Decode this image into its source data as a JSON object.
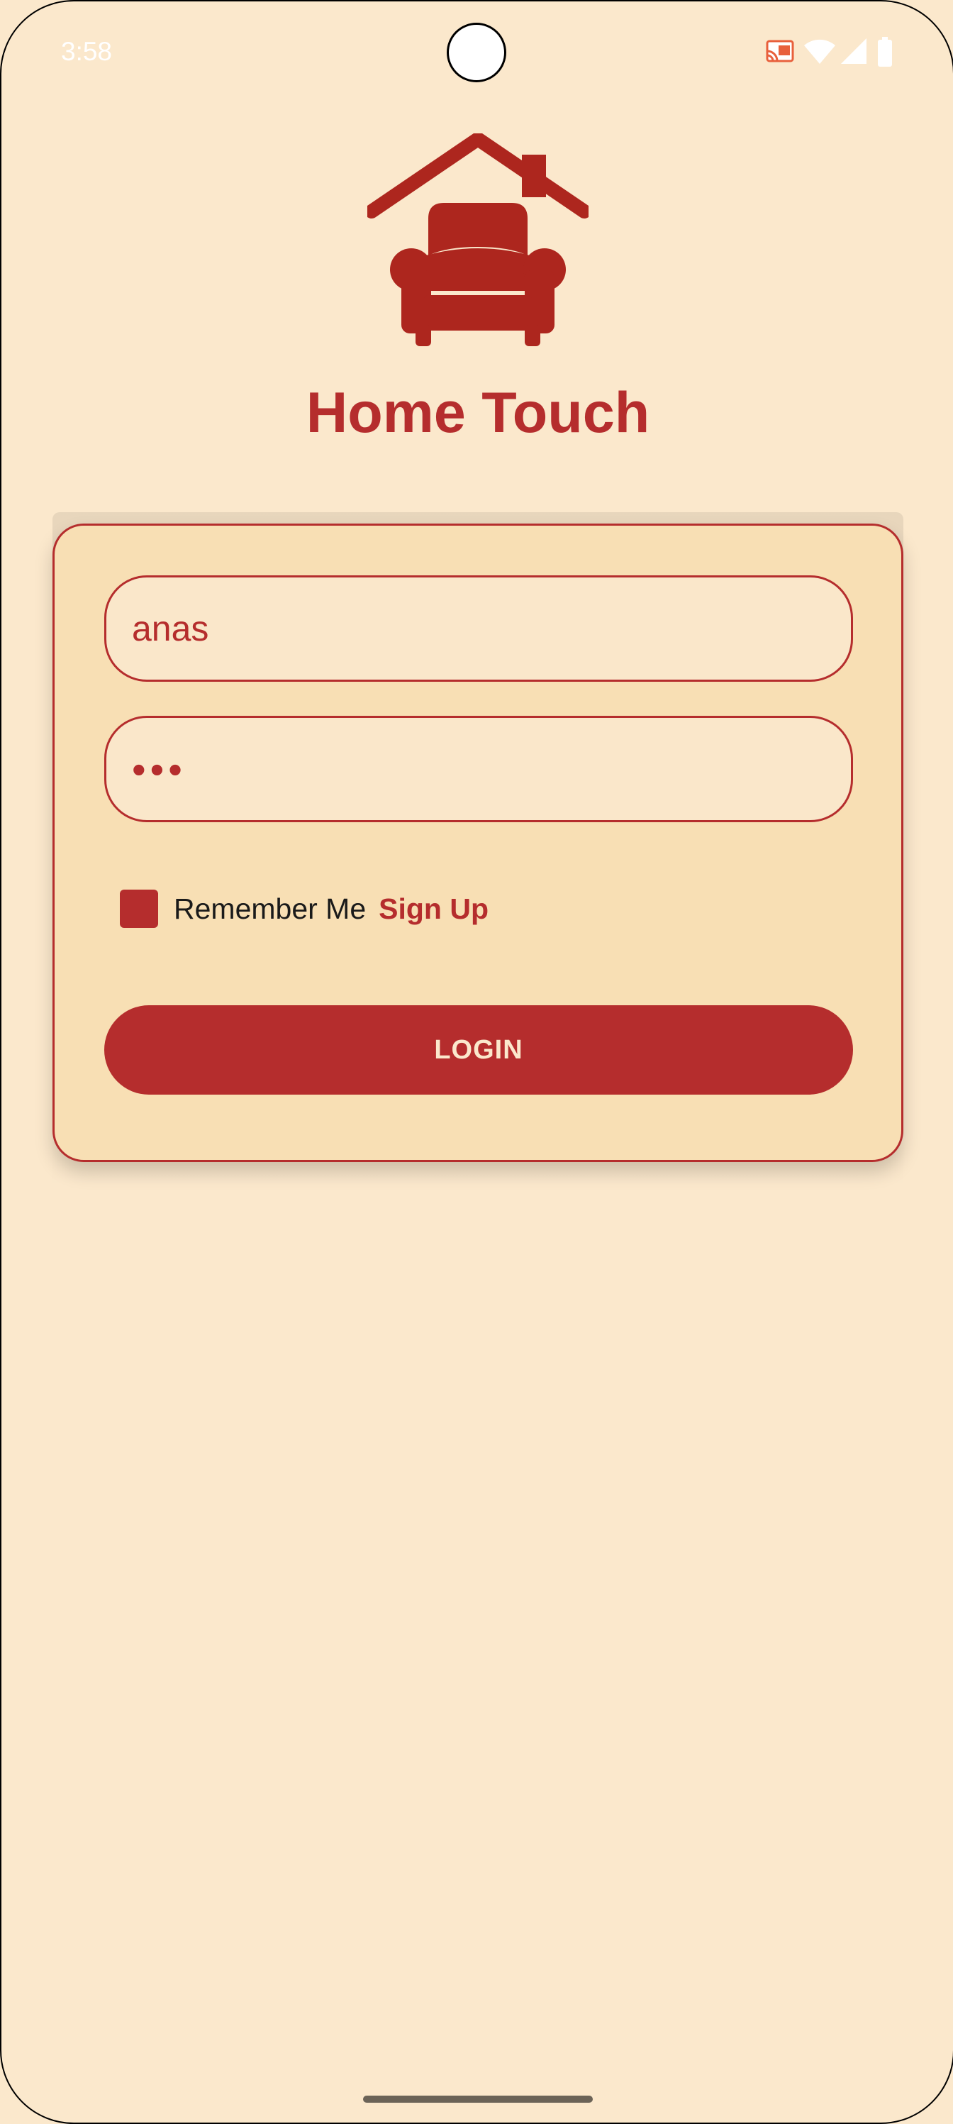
{
  "status_bar": {
    "time": "3:58",
    "icons": [
      "cast-icon",
      "wifi-icon",
      "signal-icon",
      "battery-icon"
    ]
  },
  "app": {
    "logo_icon": "house-armchair-icon",
    "title": "Home Touch"
  },
  "login_form": {
    "username": {
      "value": "anas"
    },
    "password": {
      "value": "•••"
    },
    "remember_me": {
      "label": "Remember Me",
      "checked": true
    },
    "signup_link": "Sign Up",
    "login_button": "LOGIN"
  },
  "colors": {
    "background": "#fbe8cc",
    "card": "#f8dfb4",
    "accent": "#b52d2d"
  }
}
